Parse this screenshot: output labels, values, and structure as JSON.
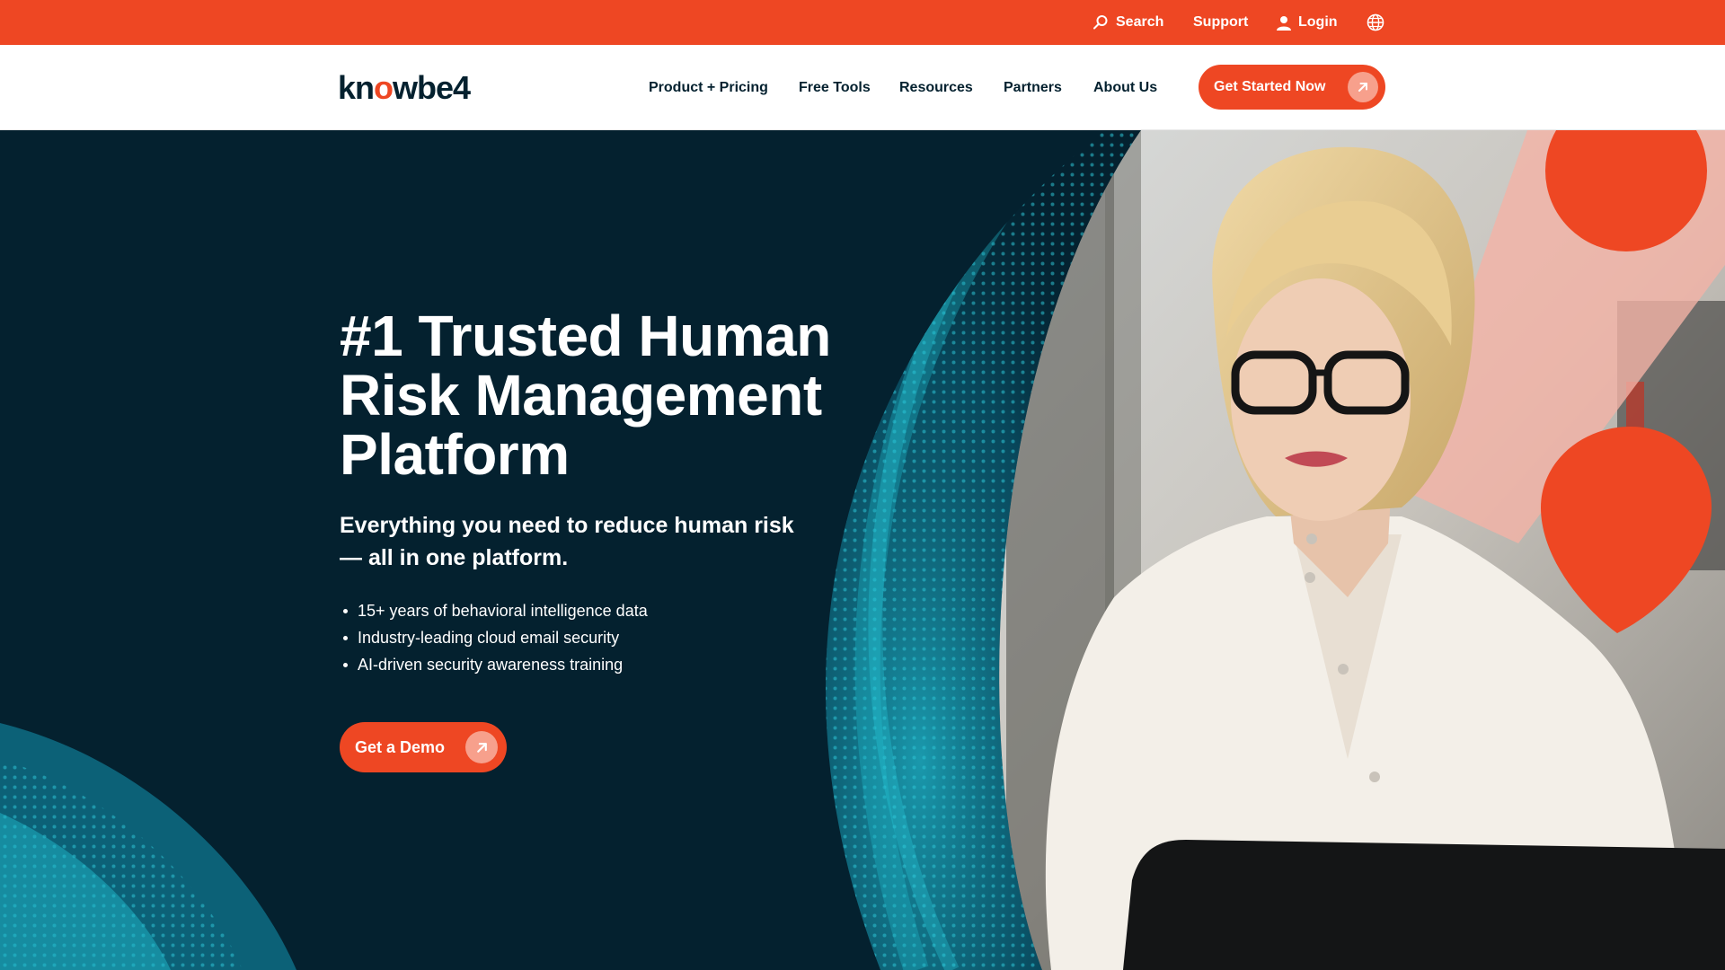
{
  "utility_bar": {
    "search_label": "Search",
    "support_label": "Support",
    "login_label": "Login",
    "language_icon": "globe-icon"
  },
  "nav": {
    "logo_text_before": "kn",
    "logo_text_accent": "o",
    "logo_text_after": "wbe4",
    "items": [
      "Product + Pricing",
      "Free Tools",
      "Resources",
      "Partners",
      "About Us"
    ],
    "cta_label": "Get Started Now"
  },
  "hero": {
    "title_lines": [
      "#1 Trusted Human",
      "Risk Management",
      "Platform"
    ],
    "subtitle": "Everything you need to reduce human risk — all in one platform.",
    "bullets": [
      "15+ years of behavioral intelligence data",
      "Industry-leading cloud email security",
      "AI-driven security awareness training"
    ],
    "cta_label": "Get a Demo"
  },
  "colors": {
    "brand_orange": "#ee4723",
    "navy": "#04212f",
    "teal": "#1fb7c9",
    "white": "#ffffff"
  }
}
